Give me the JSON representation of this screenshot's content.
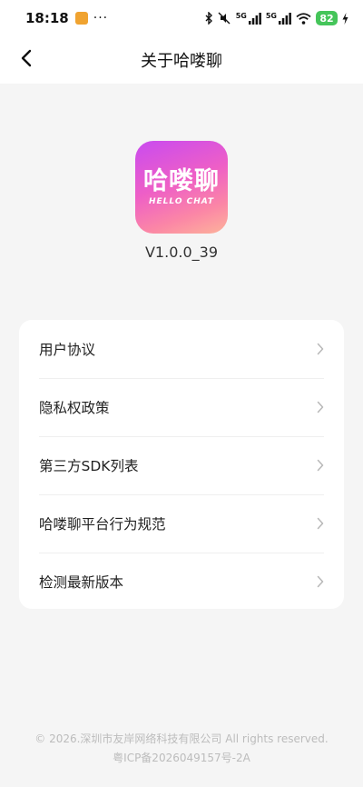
{
  "status_bar": {
    "time": "18:18",
    "more": "···",
    "signal_label_1": "5G",
    "signal_label_2": "5G",
    "battery": "82",
    "icons": [
      "bluetooth-icon",
      "mute-icon",
      "signal-icon",
      "signal-icon",
      "wifi-icon",
      "battery-icon",
      "charging-icon"
    ]
  },
  "nav": {
    "title": "关于哈喽聊",
    "back_icon": "chevron-left-icon"
  },
  "app": {
    "logo_cn": "哈喽聊",
    "logo_en": "HELLO CHAT",
    "version": "V1.0.0_39"
  },
  "menu": {
    "items": [
      {
        "label": "用户协议"
      },
      {
        "label": "隐私权政策"
      },
      {
        "label": "第三方SDK列表"
      },
      {
        "label": "哈喽聊平台行为规范"
      },
      {
        "label": "检测最新版本"
      }
    ]
  },
  "footer": {
    "copyright": "© 2026.深圳市友岸网络科技有限公司 All rights reserved.",
    "icp": "粤ICP备2026049157号-2A"
  },
  "colors": {
    "background": "#f5f5f5",
    "card": "#ffffff",
    "battery": "#45c55a",
    "logo_gradient_start": "#c94bf0",
    "logo_gradient_end": "#fdb39b"
  }
}
